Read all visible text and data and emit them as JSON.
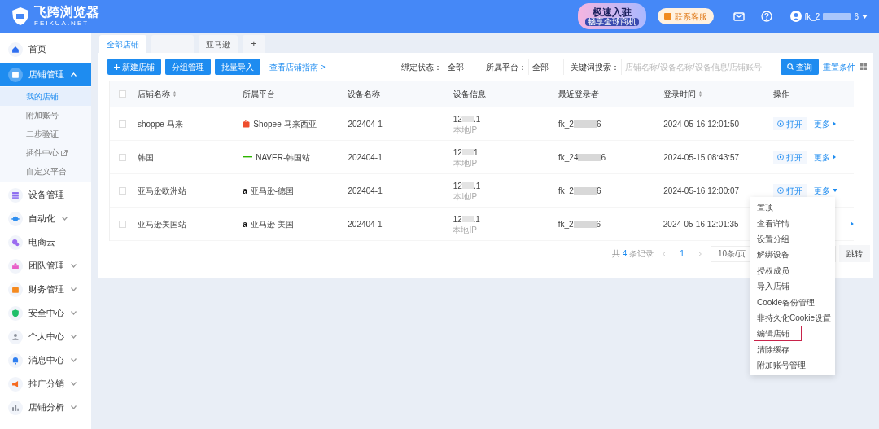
{
  "header": {
    "logo_title": "飞跨浏览器",
    "logo_subtitle": "FEIKUA.NET",
    "promo_title": "极速入驻",
    "promo_subtitle": "畅享全球商机",
    "support_button": "联系客服",
    "user_name_start": "fk_2",
    "user_name_end": "6"
  },
  "sidebar": {
    "items": [
      {
        "label": "首页",
        "selected": false
      },
      {
        "label": "店铺管理",
        "expanded": true,
        "selected": true,
        "children": [
          {
            "label": "我的店铺",
            "selected": true,
            "external": false
          },
          {
            "label": "附加账号",
            "selected": false,
            "external": false
          },
          {
            "label": "二步验证",
            "selected": false,
            "external": false
          },
          {
            "label": "插件中心",
            "selected": false,
            "external": true
          },
          {
            "label": "自定义平台",
            "selected": false,
            "external": false
          }
        ]
      },
      {
        "label": "设备管理",
        "selected": false
      },
      {
        "label": "自动化",
        "expanded": false,
        "selected": false
      },
      {
        "label": "电商云",
        "selected": false
      },
      {
        "label": "团队管理",
        "expanded": false,
        "selected": false
      },
      {
        "label": "财务管理",
        "expanded": false,
        "selected": false
      },
      {
        "label": "安全中心",
        "expanded": false,
        "selected": false
      },
      {
        "label": "个人中心",
        "expanded": false,
        "selected": false
      },
      {
        "label": "消息中心",
        "expanded": false,
        "selected": false
      },
      {
        "label": "推广分销",
        "expanded": false,
        "selected": false
      },
      {
        "label": "店铺分析",
        "expanded": false,
        "selected": false
      }
    ]
  },
  "tabs": [
    {
      "label": "全部店铺",
      "selected": true,
      "kind": "text"
    },
    {
      "selected": false,
      "kind": "blurred"
    },
    {
      "label": "亚马逊",
      "selected": false,
      "kind": "text"
    },
    {
      "label": "+",
      "selected": false,
      "kind": "add"
    }
  ],
  "toolbar": {
    "buttons": [
      "新建店铺",
      "分组管理",
      "批量导入"
    ],
    "guide_link": "查看店铺指南 >",
    "filters": [
      {
        "label": "绑定状态：",
        "value": "全部"
      },
      {
        "label": "所属平台：",
        "value": "全部"
      }
    ],
    "search_label": "关键词搜索：",
    "search": {
      "placeholder": "店铺名称/设备名称/设备信息/店铺账号"
    },
    "query_button": "查询",
    "reset_link": "重置条件"
  },
  "table": {
    "select_all_checked": false,
    "columns": [
      {
        "label": "店铺名称",
        "sortable": true
      },
      {
        "label": "所属平台",
        "sortable": false
      },
      {
        "label": "设备名称",
        "sortable": false
      },
      {
        "label": "设备信息",
        "sortable": false
      },
      {
        "label": "最近登录者",
        "sortable": false
      },
      {
        "label": "登录时间",
        "sortable": true
      },
      {
        "label": "操作",
        "sortable": false
      }
    ],
    "rows": [
      {
        "checked": false,
        "shop": "shoppe-马来",
        "kind": "bag",
        "platform": "Shopee-马来西亚",
        "device": "202404-1",
        "ip_start": "12",
        "ip_end": ".1",
        "ip_note": "本地IP",
        "user_start": "fk_2",
        "user_end": "6",
        "time": "2024-05-16 12:01:50",
        "open": "打开",
        "more": "更多",
        "menu_open": false
      },
      {
        "checked": false,
        "shop": "韩国",
        "kind": "dash",
        "platform": "NAVER-韩国站",
        "device": "202404-1",
        "ip_start": "12",
        "ip_end": "1",
        "ip_note": "本地IP",
        "user_start": "fk_24",
        "user_end": "6",
        "time": "2024-05-15 08:43:57",
        "open": "打开",
        "more": "更多",
        "menu_open": false
      },
      {
        "checked": false,
        "shop": "亚马逊欧洲站",
        "kind": "letter",
        "logo_letter": "a",
        "platform": "亚马逊-德国",
        "device": "202404-1",
        "ip_start": "12",
        "ip_end": ".1",
        "ip_note": "本地IP",
        "user_start": "fk_2",
        "user_end": "6",
        "time": "2024-05-16 12:00:07",
        "open": "打开",
        "more": "更多",
        "menu_open": true
      },
      {
        "checked": false,
        "shop": "亚马逊美国站",
        "kind": "letter",
        "logo_letter": "a",
        "platform": "亚马逊-美国",
        "device": "202404-1",
        "ip_start": "12",
        "ip_end": ".1",
        "ip_note": "本地IP",
        "user_start": "fk_2",
        "user_end": "6",
        "time": "2024-05-16 12:01:35",
        "menu_open": false
      }
    ]
  },
  "pagination": {
    "total_prefix": "共",
    "total_count": "4",
    "total_suffix": "条记录",
    "pages": [
      {
        "label": "1",
        "selected": true
      }
    ],
    "page_size": "10条/页",
    "goto_button": "跳转"
  },
  "dropdown_menu": {
    "items": [
      {
        "label": "置顶",
        "highlighted": false
      },
      {
        "label": "查看详情",
        "highlighted": false
      },
      {
        "label": "设置分组",
        "highlighted": false
      },
      {
        "label": "解绑设备",
        "highlighted": false
      },
      {
        "label": "授权成员",
        "highlighted": false
      },
      {
        "label": "导入店铺",
        "highlighted": false
      },
      {
        "label": "Cookie备份管理",
        "highlighted": false
      },
      {
        "label": "非持久化Cookie设置",
        "highlighted": false
      },
      {
        "label": "编辑店铺",
        "highlighted": true
      },
      {
        "label": "清除缓存",
        "highlighted": false
      },
      {
        "label": "附加账号管理",
        "highlighted": false
      }
    ]
  }
}
